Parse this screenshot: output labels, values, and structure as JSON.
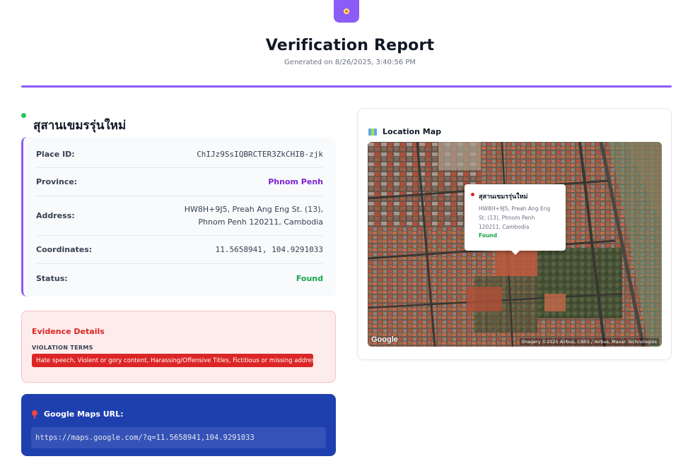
{
  "header": {
    "title": "Verification Report",
    "generated": "Generated on 8/26/2025, 3:40:56 PM"
  },
  "place": {
    "name": "สุสานเขมรรุ่นใหม่"
  },
  "info": {
    "place_id_label": "Place ID:",
    "place_id_value": "ChIJz9SsIQBRCTER3ZkCHIB-zjk",
    "province_label": "Province:",
    "province_value": "Phnom Penh",
    "address_label": "Address:",
    "address_line1": "HW8H+9J5, Preah Ang Eng St. (13),",
    "address_line2": "Phnom Penh 120211, Cambodia",
    "coordinates_label": "Coordinates:",
    "coordinates_value": "11.5658941, 104.9291033",
    "status_label": "Status:",
    "status_value": "Found"
  },
  "evidence": {
    "title": "Evidence Details",
    "subtitle": "VIOLATION TERMS",
    "terms": "Hate speech, Violent or gory content, Harassing/Offensive Titles, Fictitious or missing address"
  },
  "url": {
    "title": "Google Maps URL:",
    "value": "https://maps.google.com/?q=11.5658941,104.9291033"
  },
  "map": {
    "title": "Location Map",
    "popup_name": "สุสานเขมรรุ่นใหม่",
    "popup_addr1": "HW8H+9J5, Preah Ang Eng",
    "popup_addr2": "St. (13), Phnom Penh",
    "popup_addr3": "120211, Cambodia",
    "popup_status": "Found",
    "logo": "Google",
    "credit": "Imagery ©2025 Airbus, CNES / Airbus, Maxar Technologies"
  },
  "colors": {
    "accent": "#8b5cf6",
    "status_found": "#16a34a",
    "province": "#7e22ce",
    "evidence_red": "#dc2626",
    "url_blue": "#1e40af"
  },
  "icons": {
    "top_badge": "map-pin-icon",
    "title_dot": "status-dot-icon",
    "url_pin": "map-pin-icon",
    "map_title": "map-icon"
  }
}
